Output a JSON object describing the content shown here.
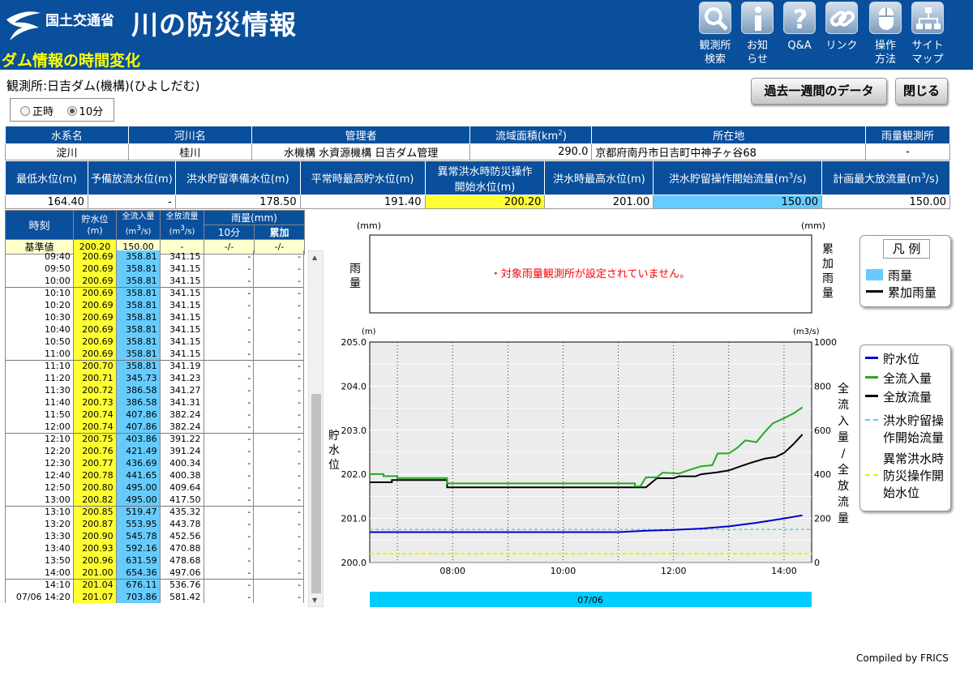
{
  "header": {
    "ministry": "国土交通省",
    "site_title": "川の防災情報",
    "page_subtitle": "ダム情報の時間変化"
  },
  "nav": [
    {
      "l1": "観測所",
      "l2": "検索",
      "icon": "search-icon"
    },
    {
      "l1": "お知",
      "l2": "らせ",
      "icon": "info-icon"
    },
    {
      "l1": "Q&A",
      "l2": "",
      "icon": "question-icon"
    },
    {
      "l1": "リンク",
      "l2": "",
      "icon": "link-icon"
    },
    {
      "l1": "操作",
      "l2": "方法",
      "icon": "mouse-icon"
    },
    {
      "l1": "サイト",
      "l2": "マップ",
      "icon": "sitemap-icon"
    }
  ],
  "station": "観測所:日吉ダム(機構)(ひよしだむ)",
  "mode": {
    "opt1": "正時",
    "opt2": "10分",
    "selected": "10分"
  },
  "buttons": {
    "week": "過去一週間のデータ",
    "close": "閉じる"
  },
  "info1": {
    "h": [
      "水系名",
      "河川名",
      "管理者",
      "流域面積(km",
      "所在地",
      "雨量観測所"
    ],
    "v": [
      "淀川",
      "桂川",
      "水機構 水資源機構 日吉ダム管理",
      "290.0",
      "京都府南丹市日吉町中神子ヶ谷68",
      "-"
    ]
  },
  "info2": {
    "h": [
      "最低水位(m)",
      "予備放流水位(m)",
      "洪水貯留準備水位(m)",
      "平常時最高貯水位(m)",
      "異常洪水時防災操作",
      "開始水位(m)",
      "洪水時最高水位(m)",
      "洪水貯留操作開始流量(m",
      "計画最大放流量(m"
    ],
    "v": [
      "164.40",
      "-",
      "178.50",
      "191.40",
      "200.20",
      "201.00",
      "150.00",
      "150.00"
    ]
  },
  "table": {
    "h_time": "時刻",
    "h_wl1": "貯水位",
    "h_wl2": "(m)",
    "h_in": "全流入量",
    "h_out": "全放流量",
    "h_unit": "(m",
    "h_rain": "雨量(mm)",
    "h_10": "10分",
    "h_acc": "累加",
    "base": {
      "label": "基準値",
      "wl": "200.20",
      "in": "150.00",
      "out": "-",
      "r10": "-/-",
      "acc": "-/-"
    },
    "rows": [
      [
        "09:40",
        "200.69",
        "358.81",
        "341.15",
        "-",
        "-"
      ],
      [
        "09:50",
        "200.69",
        "358.81",
        "341.15",
        "-",
        "-"
      ],
      [
        "10:00",
        "200.69",
        "358.81",
        "341.15",
        "-",
        "-"
      ],
      [
        "10:10",
        "200.69",
        "358.81",
        "341.15",
        "-",
        "-"
      ],
      [
        "10:20",
        "200.69",
        "358.81",
        "341.15",
        "-",
        "-"
      ],
      [
        "10:30",
        "200.69",
        "358.81",
        "341.15",
        "-",
        "-"
      ],
      [
        "10:40",
        "200.69",
        "358.81",
        "341.15",
        "-",
        "-"
      ],
      [
        "10:50",
        "200.69",
        "358.81",
        "341.15",
        "-",
        "-"
      ],
      [
        "11:00",
        "200.69",
        "358.81",
        "341.15",
        "-",
        "-"
      ],
      [
        "11:10",
        "200.70",
        "358.81",
        "341.19",
        "-",
        "-"
      ],
      [
        "11:20",
        "200.71",
        "345.73",
        "341.23",
        "-",
        "-"
      ],
      [
        "11:30",
        "200.72",
        "386.58",
        "341.27",
        "-",
        "-"
      ],
      [
        "11:40",
        "200.73",
        "386.58",
        "341.31",
        "-",
        "-"
      ],
      [
        "11:50",
        "200.74",
        "407.86",
        "382.24",
        "-",
        "-"
      ],
      [
        "12:00",
        "200.74",
        "407.86",
        "382.24",
        "-",
        "-"
      ],
      [
        "12:10",
        "200.75",
        "403.86",
        "391.22",
        "-",
        "-"
      ],
      [
        "12:20",
        "200.76",
        "421.49",
        "391.24",
        "-",
        "-"
      ],
      [
        "12:30",
        "200.77",
        "436.69",
        "400.34",
        "-",
        "-"
      ],
      [
        "12:40",
        "200.78",
        "441.65",
        "400.38",
        "-",
        "-"
      ],
      [
        "12:50",
        "200.80",
        "495.00",
        "409.64",
        "-",
        "-"
      ],
      [
        "13:00",
        "200.82",
        "495.00",
        "417.50",
        "-",
        "-"
      ],
      [
        "13:10",
        "200.85",
        "519.47",
        "435.32",
        "-",
        "-"
      ],
      [
        "13:20",
        "200.87",
        "553.95",
        "443.78",
        "-",
        "-"
      ],
      [
        "13:30",
        "200.90",
        "545.78",
        "452.56",
        "-",
        "-"
      ],
      [
        "13:40",
        "200.93",
        "592.16",
        "470.88",
        "-",
        "-"
      ],
      [
        "13:50",
        "200.96",
        "631.59",
        "478.68",
        "-",
        "-"
      ],
      [
        "14:00",
        "201.00",
        "654.36",
        "497.06",
        "-",
        "-"
      ],
      [
        "14:10",
        "201.04",
        "676.11",
        "536.76",
        "-",
        "-"
      ],
      [
        "07/06 14:20",
        "201.07",
        "703.86",
        "581.42",
        "-",
        "-"
      ]
    ]
  },
  "chart_data": {
    "type": "line",
    "rain_panel": {
      "unit_left": "(mm)",
      "unit_right": "(mm)",
      "ylabel_left": "雨量",
      "ylabel_right": "累加雨量",
      "message": "・対象雨量観測所が設定されていません。"
    },
    "left_unit": "(m)",
    "right_unit": "(m3/s)",
    "ylabel_left": "貯水位",
    "ylabel_right": "全流入量/全放流量",
    "ylim_left": [
      200.0,
      205.0
    ],
    "ylim_right": [
      0,
      1000
    ],
    "yticks_left": [
      "205.0",
      "204.0",
      "203.0",
      "202.0",
      "201.0",
      "200.0"
    ],
    "yticks_right": [
      "1000",
      "800",
      "600",
      "400",
      "200",
      "0"
    ],
    "xticks": [
      "08:00",
      "10:00",
      "12:00",
      "14:00"
    ],
    "date_label": "07/06",
    "series_names": {
      "wl": "貯水位",
      "in": "全流入量",
      "out": "全放流量",
      "thr_flow": "洪水貯留操作開始流量",
      "thr_wl": "異常洪水時防災操作開始水位"
    },
    "colors": {
      "wl": "#0000cc",
      "in": "#22aa22",
      "out": "#000000",
      "thr_flow": "#66ccee",
      "thr_wl": "#eeee00",
      "rain": "#66ccff",
      "grid": "#e6e6e6",
      "date_bar": "#00ccff"
    },
    "thresholds": {
      "flow": 150.0,
      "wl": 200.2
    },
    "wl": [
      [
        6.5,
        200.69
      ],
      [
        9.0,
        200.69
      ],
      [
        11.0,
        200.69
      ],
      [
        11.5,
        200.72
      ],
      [
        12.0,
        200.74
      ],
      [
        12.5,
        200.77
      ],
      [
        13.0,
        200.82
      ],
      [
        13.5,
        200.9
      ],
      [
        14.0,
        201.0
      ],
      [
        14.333,
        201.07
      ]
    ],
    "in": [
      [
        6.5,
        401
      ],
      [
        6.75,
        401
      ],
      [
        6.75,
        392
      ],
      [
        7.0,
        392
      ],
      [
        7.0,
        383
      ],
      [
        7.9,
        383
      ],
      [
        7.9,
        358.81
      ],
      [
        11.3,
        358.81
      ],
      [
        11.3,
        345.73
      ],
      [
        11.4,
        345.73
      ],
      [
        11.5,
        386.58
      ],
      [
        11.7,
        386.58
      ],
      [
        11.8,
        407.86
      ],
      [
        12.1,
        403.86
      ],
      [
        12.3,
        421.49
      ],
      [
        12.5,
        436.69
      ],
      [
        12.7,
        441.65
      ],
      [
        12.8,
        495.0
      ],
      [
        13.0,
        495.0
      ],
      [
        13.15,
        519.47
      ],
      [
        13.3,
        553.95
      ],
      [
        13.5,
        545.78
      ],
      [
        13.65,
        592.16
      ],
      [
        13.8,
        631.59
      ],
      [
        14.0,
        654.36
      ],
      [
        14.17,
        676.11
      ],
      [
        14.333,
        703.86
      ]
    ],
    "out": [
      [
        6.5,
        364
      ],
      [
        6.9,
        364
      ],
      [
        6.9,
        374
      ],
      [
        7.9,
        374
      ],
      [
        7.9,
        341.15
      ],
      [
        11.5,
        341.15
      ],
      [
        11.7,
        382.24
      ],
      [
        12.0,
        382.24
      ],
      [
        12.1,
        391.22
      ],
      [
        12.4,
        391.24
      ],
      [
        12.5,
        400.34
      ],
      [
        12.8,
        409.64
      ],
      [
        13.0,
        417.5
      ],
      [
        13.2,
        435.32
      ],
      [
        13.4,
        452.56
      ],
      [
        13.65,
        470.88
      ],
      [
        13.85,
        478.68
      ],
      [
        14.0,
        497.06
      ],
      [
        14.17,
        536.76
      ],
      [
        14.333,
        581.42
      ]
    ],
    "legend_rain": {
      "title": "凡 例",
      "rain": "雨量",
      "acc": "累加雨量"
    },
    "legend_main": {
      "wl": "貯水位",
      "in": "全流入量",
      "out": "全放流量",
      "thr_flow_1": "洪水貯留操",
      "thr_flow_2": "作開始流量",
      "thr_wl_1": "異常洪水時",
      "thr_wl_2": "防災操作開",
      "thr_wl_3": "始水位"
    }
  },
  "footer": "Compiled by FRICS"
}
